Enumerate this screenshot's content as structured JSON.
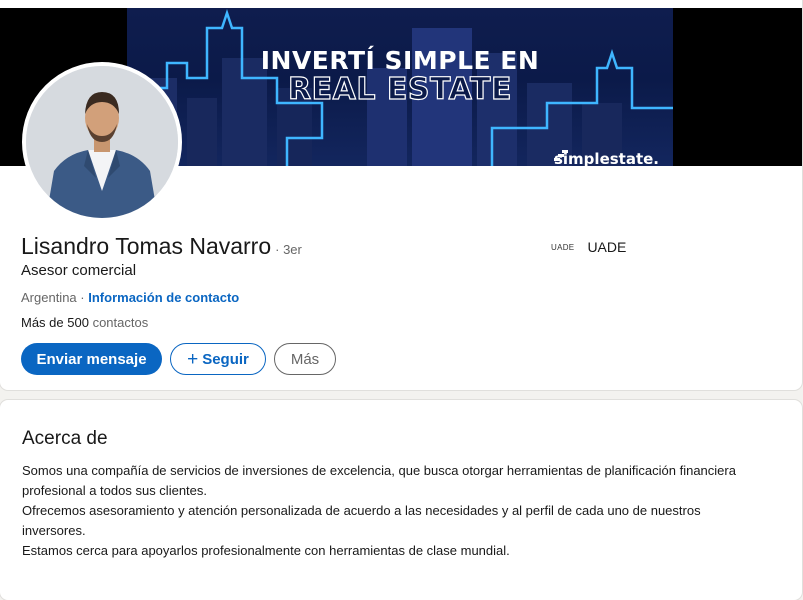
{
  "banner": {
    "headline_line1": "INVERTÍ SIMPLE EN",
    "headline_line2": "REAL ESTATE",
    "brand": "simplestate."
  },
  "profile": {
    "name": "Lisandro Tomas Navarro",
    "degree": "· 3er",
    "headline": "Asesor comercial",
    "location": "Argentina",
    "location_separator": "·",
    "contact_info_link": "Información de contacto",
    "connections_count": "Más de 500",
    "connections_suffix": "contactos",
    "education_logo": "UADE",
    "education_name": "UADE"
  },
  "actions": {
    "message": "Enviar mensaje",
    "follow": "Seguir",
    "follow_icon": "+",
    "more": "Más"
  },
  "about": {
    "title": "Acerca de",
    "lines": [
      "Somos una compañía de servicios de inversiones de excelencia, que busca otorgar herramientas de planificación financiera",
      "profesional a todos sus clientes.",
      "Ofrecemos asesoramiento y atención personalizada de acuerdo a las necesidades y al perfil de cada uno de nuestros",
      "inversores.",
      "Estamos cerca para apoyarlos profesionalmente con herramientas de clase mundial."
    ]
  },
  "colors": {
    "primary": "#0a66c2",
    "background": "#f3f2ef",
    "banner_bg": "#0b1a49",
    "neon": "#3fb6ff"
  }
}
